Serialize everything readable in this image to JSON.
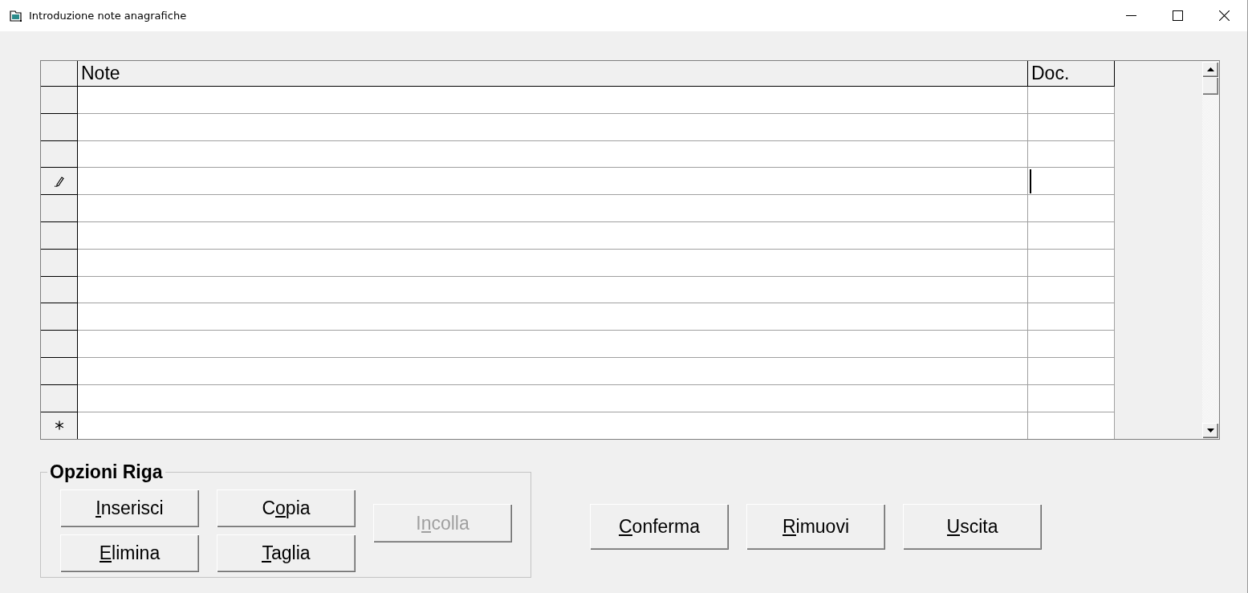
{
  "window": {
    "title": "Introduzione note anagrafiche"
  },
  "grid": {
    "columns": [
      {
        "label": "Note"
      },
      {
        "label": "Doc."
      }
    ],
    "rows": [
      {
        "kind": "normal",
        "doc_caret": false
      },
      {
        "kind": "normal",
        "doc_caret": false
      },
      {
        "kind": "normal",
        "doc_caret": false
      },
      {
        "kind": "editing",
        "doc_caret": true
      },
      {
        "kind": "normal",
        "doc_caret": false
      },
      {
        "kind": "normal",
        "doc_caret": false
      },
      {
        "kind": "normal",
        "doc_caret": false
      },
      {
        "kind": "normal",
        "doc_caret": false
      },
      {
        "kind": "normal",
        "doc_caret": false
      },
      {
        "kind": "normal",
        "doc_caret": false
      },
      {
        "kind": "normal",
        "doc_caret": false
      },
      {
        "kind": "normal",
        "doc_caret": false
      },
      {
        "kind": "new",
        "doc_caret": false
      }
    ]
  },
  "row_options": {
    "title": "Opzioni Riga",
    "button_columns": [
      [
        {
          "label": "Inserisci",
          "first_letter_underlined": true,
          "second_letter_underlined": false,
          "disabled": false
        },
        {
          "label": "Elimina",
          "first_letter_underlined": true,
          "second_letter_underlined": false,
          "disabled": false
        }
      ],
      [
        {
          "label": "Copia",
          "first_letter_underlined": false,
          "second_letter_underlined": true,
          "disabled": false
        },
        {
          "label": "Taglia",
          "first_letter_underlined": true,
          "second_letter_underlined": false,
          "disabled": false
        }
      ],
      [
        {
          "label": "Incolla",
          "first_letter_underlined": false,
          "second_letter_underlined": true,
          "disabled": true
        }
      ]
    ]
  },
  "actions": [
    {
      "label": "Conferma",
      "first_letter_underlined": true,
      "second_letter_underlined": false,
      "disabled": false
    },
    {
      "label": "Rimuovi",
      "first_letter_underlined": true,
      "second_letter_underlined": false,
      "disabled": false
    },
    {
      "label": "Uscita",
      "first_letter_underlined": true,
      "second_letter_underlined": false,
      "disabled": false
    }
  ]
}
